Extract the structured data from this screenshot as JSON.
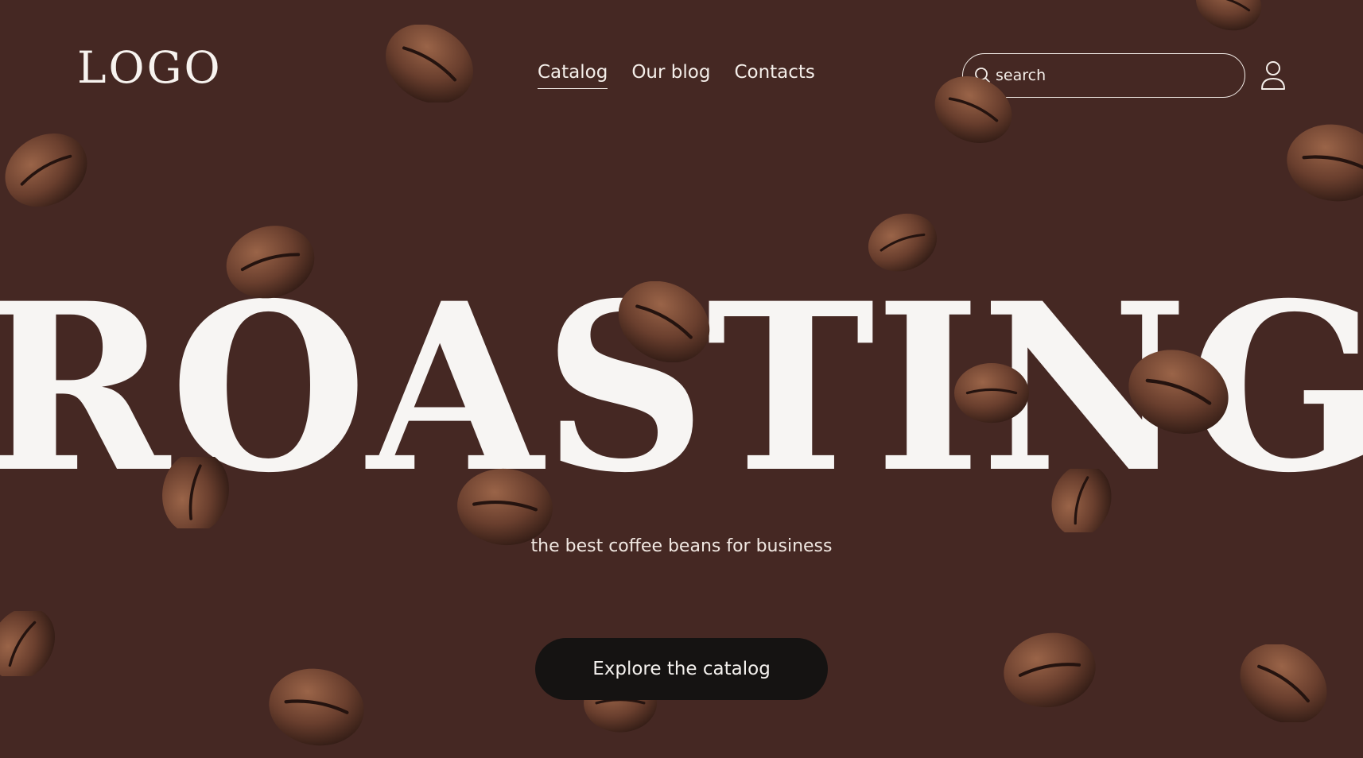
{
  "header": {
    "logo": "LOGO",
    "nav": [
      {
        "label": "Catalog",
        "active": true
      },
      {
        "label": "Our blog",
        "active": false
      },
      {
        "label": "Contacts",
        "active": false
      }
    ],
    "search": {
      "placeholder": "search",
      "value": "",
      "icon": "search-icon"
    },
    "account_icon": "user-icon"
  },
  "hero": {
    "headline": "ROASTING",
    "tagline": "the best coffee beans for business",
    "cta_label": "Explore the catalog"
  },
  "colors": {
    "background": "#452823",
    "text": "#f7f5f3",
    "button": "#151312"
  }
}
